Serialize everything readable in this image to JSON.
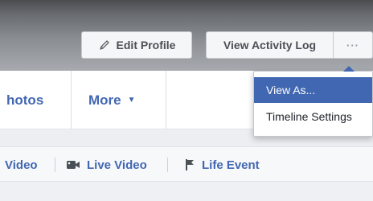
{
  "header": {
    "edit_profile_label": "Edit Profile",
    "activity_log_label": "View Activity Log",
    "more_label": "···",
    "pencil_icon": "pencil-icon"
  },
  "nav": {
    "tabs": [
      {
        "label": "hotos"
      },
      {
        "label": "More"
      }
    ],
    "more_caret": "▼"
  },
  "composer": {
    "items": [
      {
        "label": "Video"
      },
      {
        "label": "Live Video",
        "icon": "live-video-icon"
      },
      {
        "label": "Life Event",
        "icon": "flag-icon"
      }
    ]
  },
  "dropdown": {
    "items": [
      {
        "label": "View As...",
        "state": "highlighted"
      },
      {
        "label": "Timeline Settings"
      }
    ]
  },
  "colors": {
    "link_blue": "#4267b2",
    "highlight": "#4267b2"
  }
}
